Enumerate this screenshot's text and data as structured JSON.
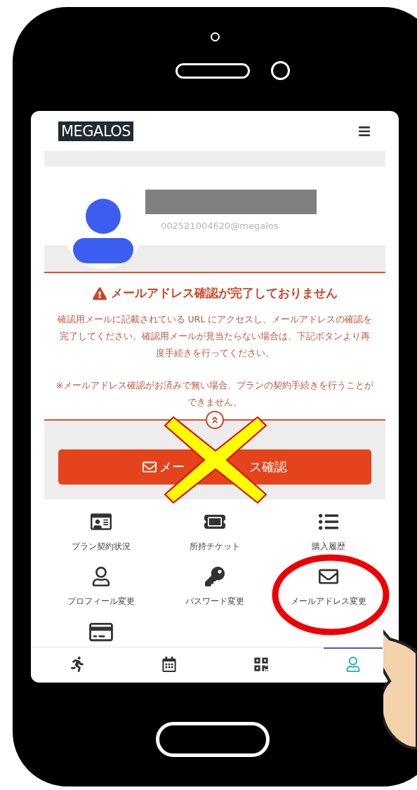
{
  "logo": "MEGALOS",
  "profile": {
    "email": "002521004620@megalos"
  },
  "alert": {
    "title": "メールアドレス確認が完了しておりません",
    "message": "確認用メールに記載されている URL にアクセスし、メールアドレスの確認を完了してください。確認用メールが見当たらない場合は、下記ボタンより再度手続きを行ってください。",
    "note": "※メールアドレス確認がお済みで無い場合、プランの契約手続きを行うことができません。"
  },
  "confirm_button": {
    "label_parts": [
      "メー",
      "ス確認"
    ]
  },
  "menu": [
    {
      "label": "プラン契約状況"
    },
    {
      "label": "所持チケット"
    },
    {
      "label": "購入履歴"
    },
    {
      "label": "プロフィール変更"
    },
    {
      "label": "パスワード変更"
    },
    {
      "label": "メールアドレス変更"
    }
  ],
  "tab_bar": [
    {
      "selected": false
    },
    {
      "selected": false
    },
    {
      "selected": false
    },
    {
      "selected": true
    }
  ]
}
